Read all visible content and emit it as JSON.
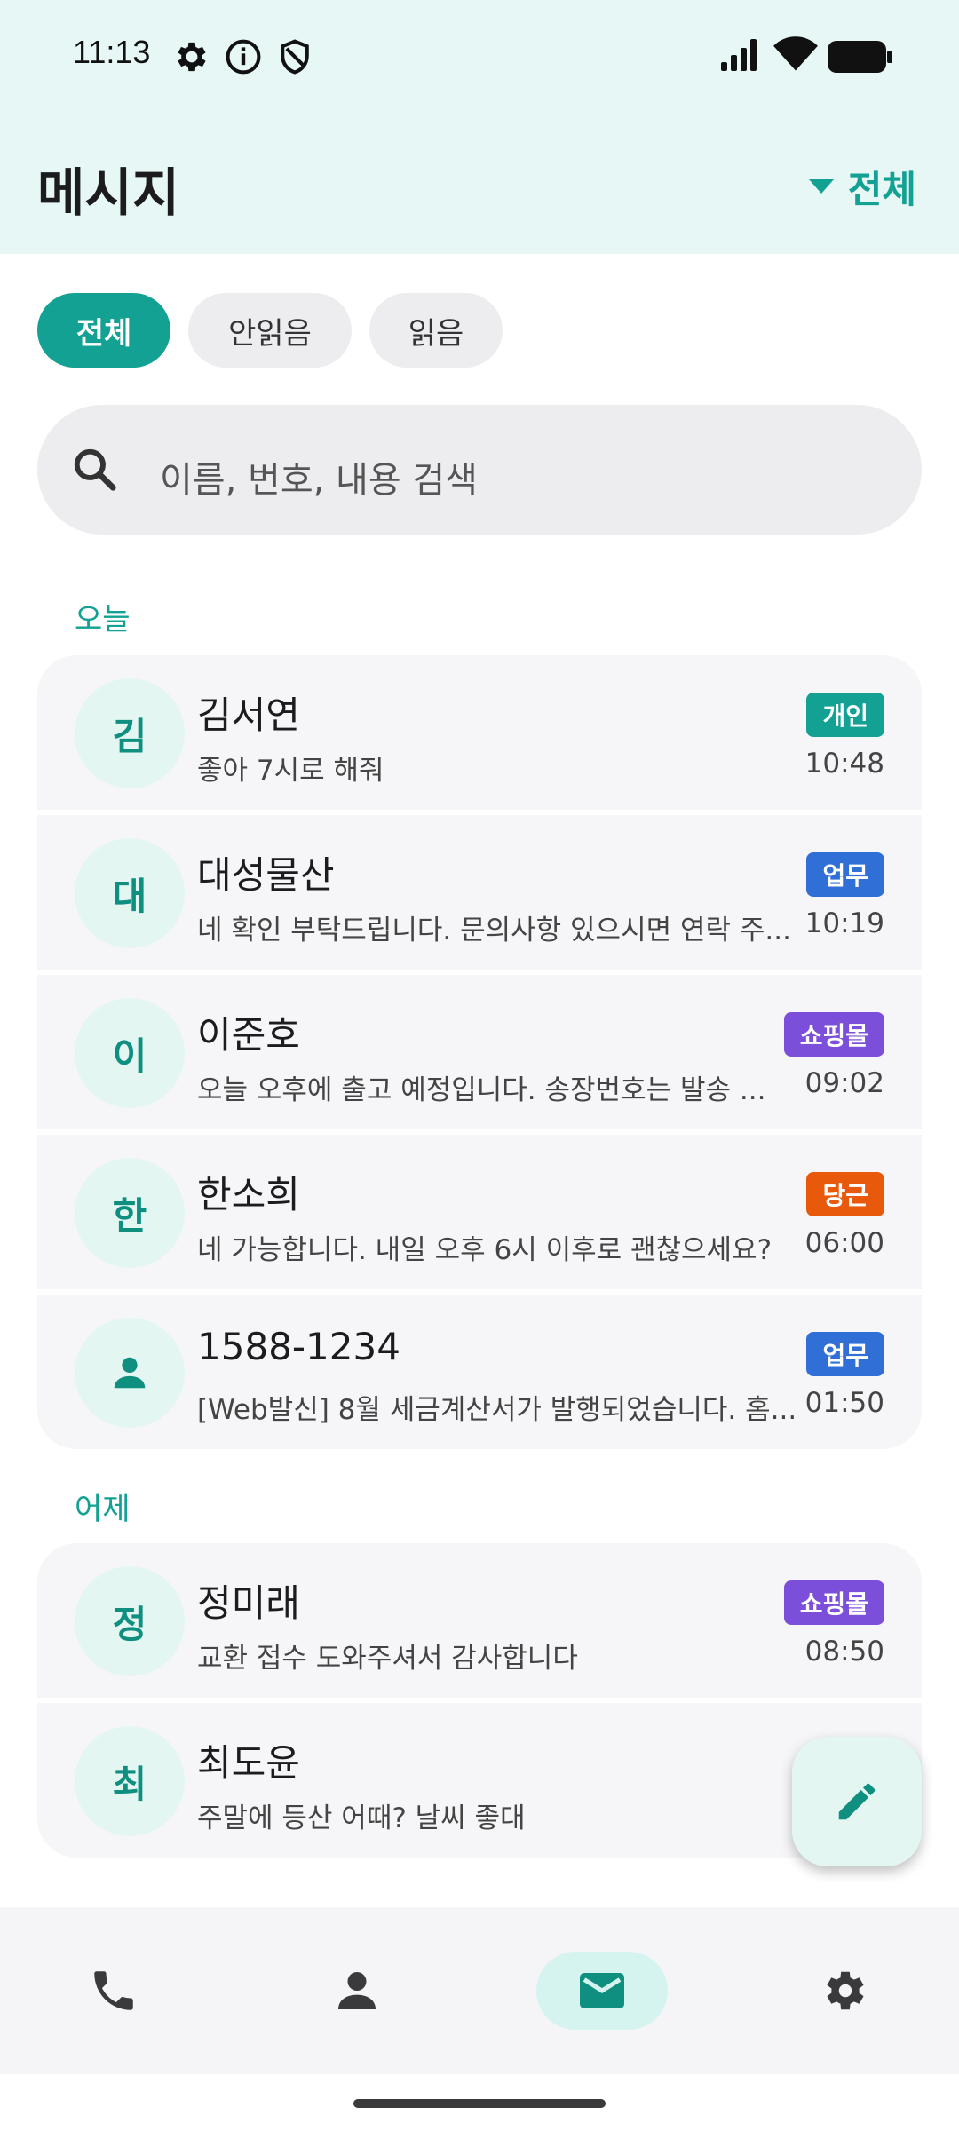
{
  "status_bar": {
    "time": "11:13",
    "left_icons": [
      "gear-icon",
      "info-icon",
      "shield-icon"
    ],
    "right_icons": [
      "signal-icon",
      "wifi-icon",
      "battery-icon"
    ]
  },
  "header": {
    "title": "메시지",
    "filter_label": "전체"
  },
  "filters": [
    {
      "label": "전체",
      "active": true
    },
    {
      "label": "안읽음",
      "active": false
    },
    {
      "label": "읽음",
      "active": false
    }
  ],
  "search": {
    "placeholder": "이름, 번호, 내용 검색"
  },
  "colors": {
    "accent": "#12a192",
    "badge_personal": "#12a192",
    "badge_work": "#2f6fd6",
    "badge_shopping": "#7b4fd9",
    "badge_karrot": "#e8590c"
  },
  "sections": [
    {
      "label": "오늘",
      "conversations": [
        {
          "avatar": "김",
          "name": "김서연",
          "preview": "좋아 7시로 해줘",
          "badge": "개인",
          "time": "10:48"
        },
        {
          "avatar": "대",
          "name": "대성물산",
          "preview": "네 확인 부탁드립니다. 문의사항 있으시면 연락 주...",
          "badge": "업무",
          "time": "10:19"
        },
        {
          "avatar": "이",
          "name": "이준호",
          "preview": "오늘 오후에 출고 예정입니다. 송장번호는 발송 ...",
          "badge": "쇼핑몰",
          "time": "09:02"
        },
        {
          "avatar": "한",
          "name": "한소희",
          "preview": "네 가능합니다. 내일 오후 6시 이후로 괜찮으세요?",
          "badge": "당근",
          "time": "06:00"
        },
        {
          "avatar": "person-icon",
          "name": "1588-1234",
          "preview": "[Web발신] 8월 세금계산서가 발행되었습니다. 홈...",
          "badge": "업무",
          "time": "01:50"
        }
      ]
    },
    {
      "label": "어제",
      "conversations": [
        {
          "avatar": "정",
          "name": "정미래",
          "preview": "교환 접수 도와주셔서 감사합니다",
          "badge": "쇼핑몰",
          "time": "08:50"
        },
        {
          "avatar": "최",
          "name": "최도윤",
          "preview": "주말에 등산 어때? 날씨 좋대",
          "badge": "",
          "time": ""
        }
      ]
    }
  ],
  "fab": {
    "icon": "pencil-icon"
  },
  "bottom_nav": [
    {
      "icon": "phone-icon",
      "active": false
    },
    {
      "icon": "person-icon",
      "active": false
    },
    {
      "icon": "mail-icon",
      "active": true
    },
    {
      "icon": "gear-icon",
      "active": false
    }
  ]
}
